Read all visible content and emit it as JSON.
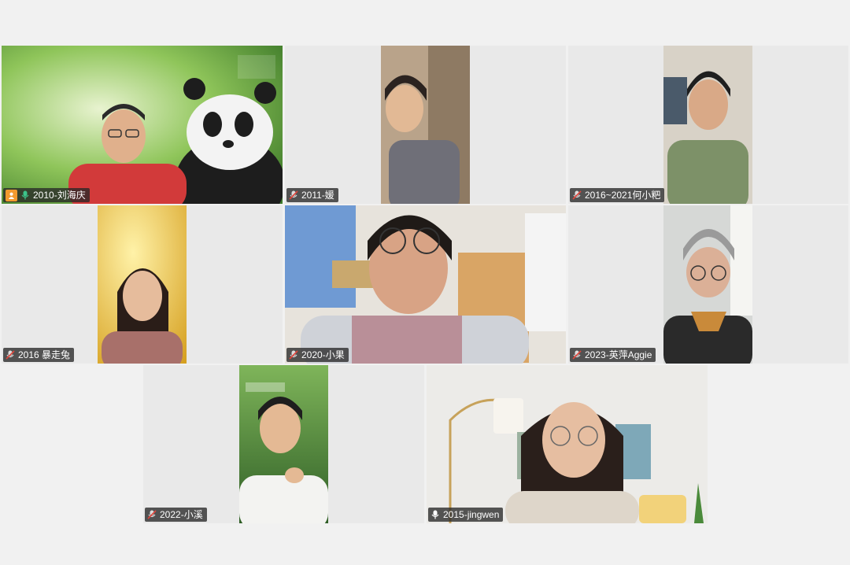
{
  "participants": [
    {
      "name": "2010-刘海庆",
      "role": "host",
      "mic": "speaking",
      "active": true
    },
    {
      "name": "2011-媛",
      "mic": "muted"
    },
    {
      "name": "2016~2021何小粑",
      "mic": "muted"
    },
    {
      "name": "2016 暴走兔",
      "mic": "muted"
    },
    {
      "name": "2020-小果",
      "mic": "muted"
    },
    {
      "name": "2023-英萍Aggie",
      "mic": "muted"
    },
    {
      "name": "2022-小溪",
      "mic": "muted"
    },
    {
      "name": "2015-jingwen",
      "mic": "on"
    }
  ],
  "backgrounds": {
    "panda_banner": "宋国家公园公园",
    "forest_banner": "我在国家公园办公"
  },
  "colors": {
    "active_border": "#2ecc8f",
    "host_badge": "#f29a2e",
    "muted_red": "#e0463c",
    "tile_bg": "#e9e9e9"
  }
}
